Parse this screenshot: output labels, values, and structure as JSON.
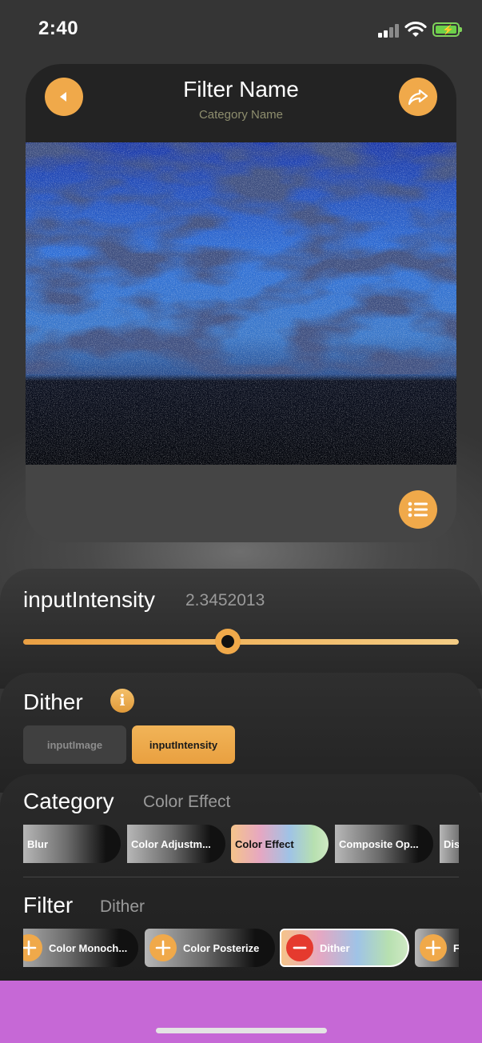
{
  "status": {
    "time": "2:40"
  },
  "header": {
    "title": "Filter Name",
    "subtitle": "Category Name"
  },
  "parameter": {
    "name": "inputIntensity",
    "value": "2.3452013",
    "slider_fraction": 0.47
  },
  "filter_info": {
    "name": "Dither",
    "inputs": [
      {
        "label": "inputImage",
        "selected": false
      },
      {
        "label": "inputIntensity",
        "selected": true
      }
    ]
  },
  "category": {
    "title": "Category",
    "selected": "Color Effect",
    "items": [
      "Blur",
      "Color Adjustm...",
      "Color Effect",
      "Composite Op...",
      "Dis"
    ]
  },
  "filter": {
    "title": "Filter",
    "selected": "Dither",
    "items": [
      "Color Monoch...",
      "Color Posterize",
      "Dither",
      "F"
    ]
  },
  "colors": {
    "accent": "#f0a94a",
    "remove": "#e53a2e",
    "bottom_bar": "#c668d6"
  },
  "icons": [
    "back-icon",
    "share-icon",
    "list-icon",
    "info-icon",
    "add-icon",
    "remove-icon"
  ]
}
